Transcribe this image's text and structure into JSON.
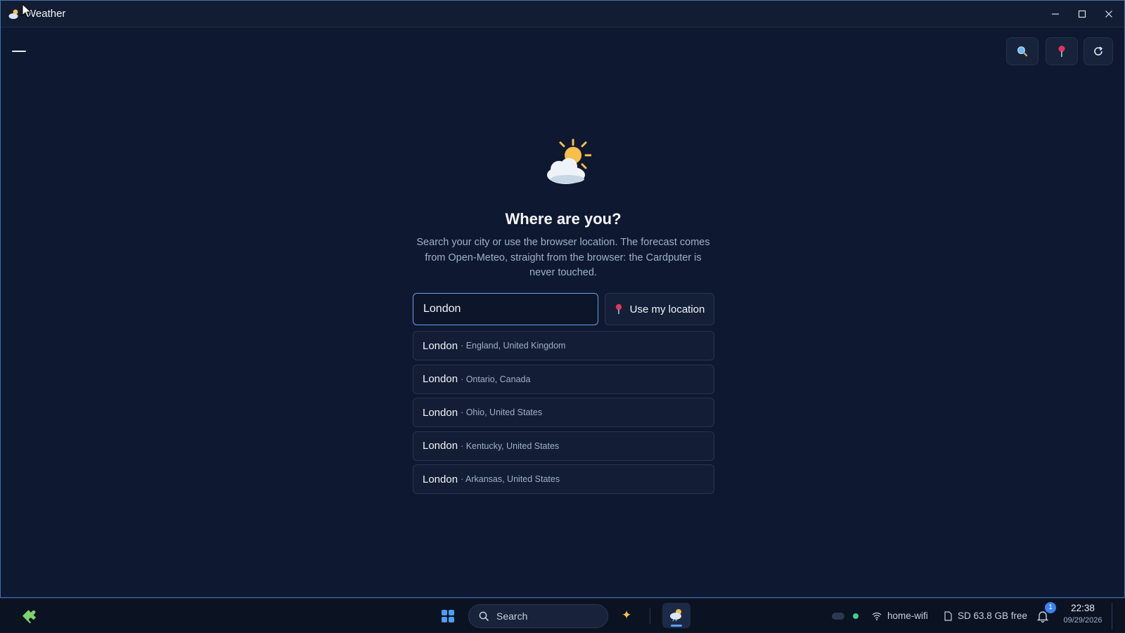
{
  "window": {
    "title": "Weather"
  },
  "main": {
    "heading": "Where are you?",
    "description": "Search your city or use the browser location. The forecast comes from Open-Meteo, straight from the browser: the Cardputer is never touched.",
    "search_value": "London",
    "location_button_label": "Use my location",
    "results": [
      {
        "city": "London",
        "region": "· England, United Kingdom"
      },
      {
        "city": "London",
        "region": "· Ontario, Canada"
      },
      {
        "city": "London",
        "region": "· Ohio, United States"
      },
      {
        "city": "London",
        "region": "· Kentucky, United States"
      },
      {
        "city": "London",
        "region": "· Arkansas, United States"
      }
    ]
  },
  "taskbar": {
    "search_placeholder": "Search",
    "wifi_name": "home-wifi",
    "storage": "SD 63.8 GB free",
    "notification_count": "1",
    "time": "22:38",
    "date": "09/29/2026"
  },
  "colors": {
    "background": "#0e1830",
    "accent": "#4f9df7",
    "pin": "#e0345a",
    "sun": "#f6c04a"
  }
}
